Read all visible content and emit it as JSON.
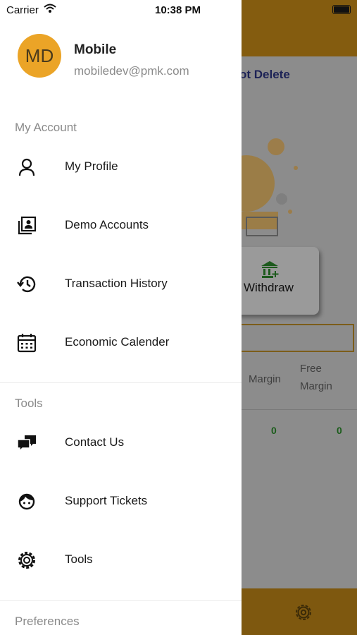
{
  "status_bar": {
    "carrier": "Carrier",
    "time": "10:38 PM"
  },
  "drawer": {
    "avatar_initials": "MD",
    "user_name": "Mobile",
    "user_email": "mobiledev@pmk.com",
    "sections": {
      "account": "My Account",
      "tools": "Tools",
      "preferences": "Preferences"
    },
    "items": {
      "my_profile": "My Profile",
      "demo_accounts": "Demo Accounts",
      "transaction_history": "Transaction History",
      "economic_calender": "Economic Calender",
      "contact_us": "Contact Us",
      "support_tickets": "Support Tickets",
      "tools": "Tools"
    }
  },
  "background": {
    "title_fragment": "ot Delete",
    "withdraw_label": "Withdraw",
    "col_margin": "Margin",
    "col_free": "Free",
    "col_free_margin": "Margin",
    "value_margin": "0",
    "value_free_margin": "0"
  },
  "colors": {
    "avatar": "#eba427",
    "brand_dark": "#845c0f"
  }
}
